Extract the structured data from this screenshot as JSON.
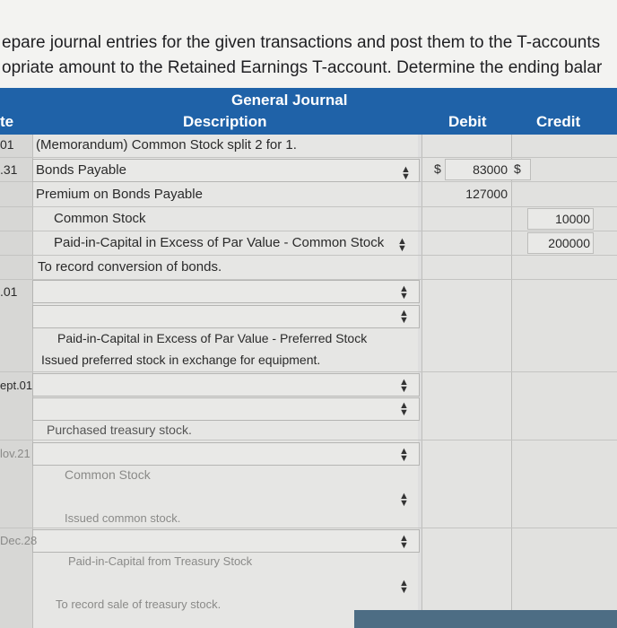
{
  "instructions": {
    "line1": "epare journal entries for the given transactions and post them to the T-accounts",
    "line2": "opriate amount to the Retained Earnings T-account. Determine the ending balar"
  },
  "journal": {
    "title": "General Journal",
    "col_date": "te",
    "col_description": "Description",
    "col_debit": "Debit",
    "col_credit": "Credit"
  },
  "rows": {
    "r1_date": "01",
    "r1_desc": "(Memorandum) Common Stock split 2 for 1.",
    "r2_date": ".31",
    "r2_desc": "Bonds Payable",
    "r2_debit_currency": "$",
    "r2_debit": "83000",
    "r2_credit_currency": "$",
    "r3_desc": "Premium on Bonds Payable",
    "r3_debit": "127000",
    "r4_desc": "Common Stock",
    "r4_credit": "10000",
    "r5_desc": "Paid-in-Capital in Excess of Par Value - Common Stock",
    "r5_credit": "200000",
    "r6_desc": "To record conversion of bonds.",
    "r7_date": ".01",
    "r9_desc": "Paid-in-Capital in Excess of Par Value - Preferred Stock",
    "r10_desc": "Issued preferred stock in exchange for equipment.",
    "r11_date": "ept.01",
    "r13_desc": "Purchased treasury stock.",
    "r14_date": "lov.21",
    "r15_desc": "Common Stock",
    "r16_desc": "Issued common stock.",
    "r17_date": "Dec.28",
    "r18_desc": "Paid-in-Capital from Treasury Stock",
    "r19_desc": "To record sale of treasury stock."
  },
  "icons": {
    "spinner": "updown-arrows-icon"
  },
  "colors": {
    "header_bg": "#1f62a8",
    "header_text": "#ffffff"
  }
}
